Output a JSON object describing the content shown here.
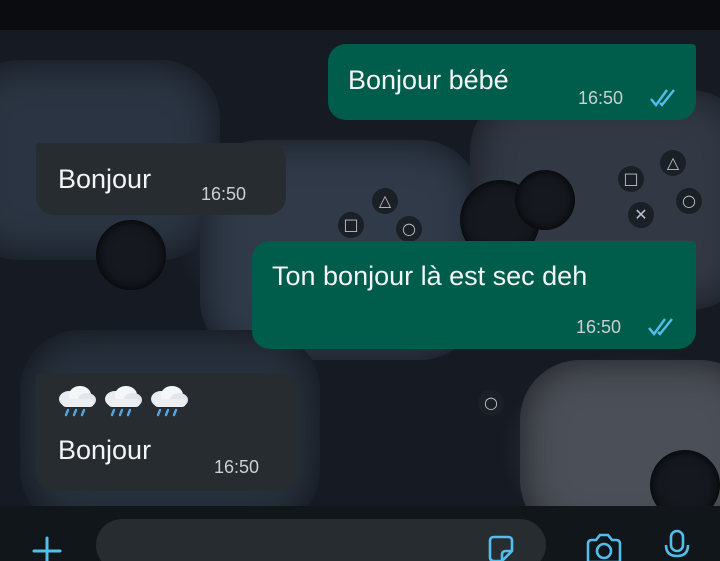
{
  "conversation": {
    "messages": [
      {
        "direction": "outgoing",
        "text": "Bonjour bébé",
        "time": "16:50",
        "status": "read"
      },
      {
        "direction": "incoming",
        "text": "Bonjour",
        "time": "16:50"
      },
      {
        "direction": "outgoing",
        "text": "Ton bonjour là est sec deh",
        "time": "16:50",
        "status": "read"
      },
      {
        "direction": "incoming",
        "emoji": [
          "cloud-with-rain",
          "cloud-with-rain",
          "cloud-with-rain"
        ],
        "text": "Bonjour",
        "time": "16:50"
      }
    ]
  },
  "input_bar": {
    "icons": [
      "plus-icon",
      "sticker-icon",
      "camera-icon",
      "microphone-icon"
    ]
  },
  "colors": {
    "outgoing_bubble": "#005c4b",
    "incoming_bubble": "#262c30",
    "read_ticks": "#53bdeb",
    "accent": "#53bdeb"
  }
}
